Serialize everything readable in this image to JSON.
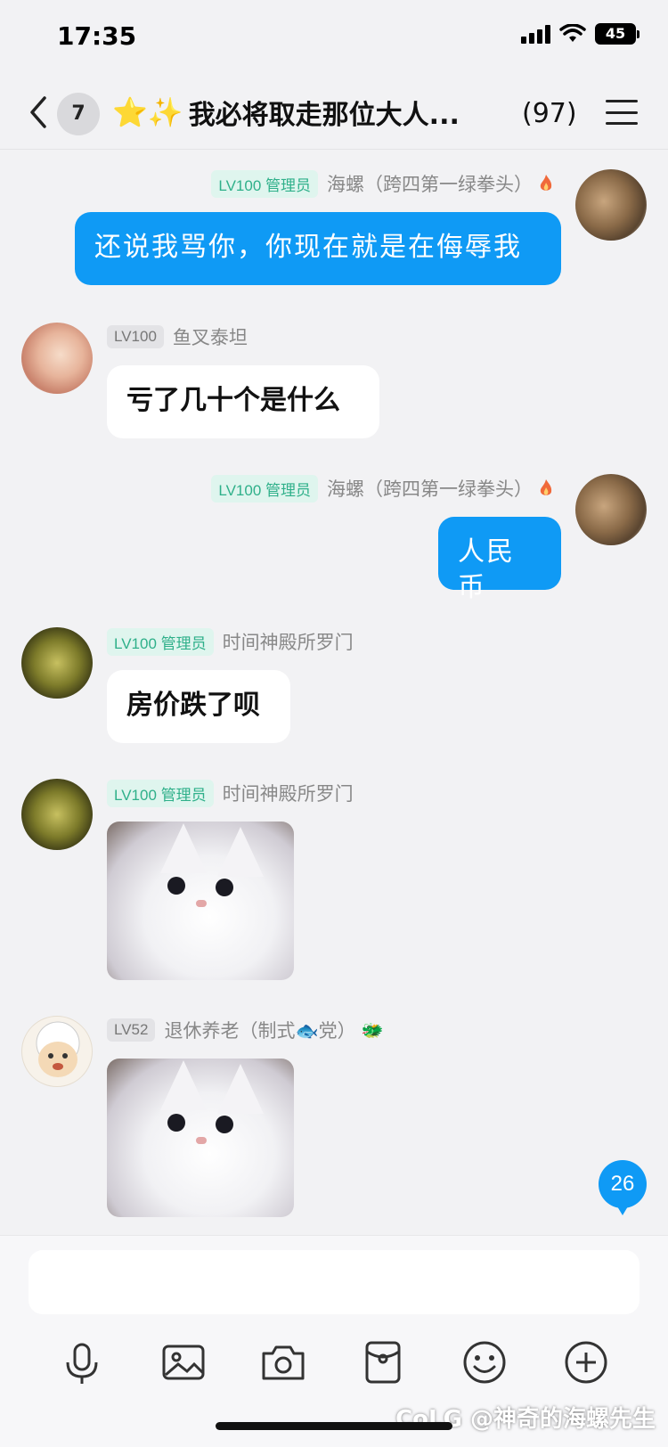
{
  "status_bar": {
    "time": "17:35",
    "battery": "45"
  },
  "header": {
    "unread_count": "7",
    "title_emoji": "⭐✨",
    "title": "我必将取走那位大人...",
    "member_count": "(97)"
  },
  "messages": [
    {
      "side": "right",
      "badge": "LV100 管理员",
      "nickname": "海螺（跨四第一绿拳头）",
      "type": "text",
      "text": "还说我骂你，你现在就是在侮辱我"
    },
    {
      "side": "left",
      "badge": "LV100",
      "nickname": "鱼叉泰坦",
      "type": "text",
      "text": "亏了几十个是什么"
    },
    {
      "side": "right",
      "badge": "LV100 管理员",
      "nickname": "海螺（跨四第一绿拳头）",
      "type": "text",
      "text": "人民币"
    },
    {
      "side": "left",
      "badge": "LV100 管理员",
      "nickname": "时间神殿所罗门",
      "type": "text",
      "text": "房价跌了呗"
    },
    {
      "side": "left",
      "badge": "LV100 管理员",
      "nickname": "时间神殿所罗门",
      "type": "image",
      "image": "white-cat-meme"
    },
    {
      "side": "left",
      "badge": "LV52",
      "nickname": "退休养老（制式🐟党）",
      "nickname_emoji": "🐲",
      "type": "image",
      "image": "white-cat-meme"
    }
  ],
  "unread_bubble": "26",
  "toolbar": [
    "microphone-icon",
    "image-icon",
    "camera-icon",
    "red-packet-icon",
    "emoji-icon",
    "plus-icon"
  ],
  "watermark": "CoLG @神奇的海螺先生",
  "colors": {
    "accent_blue": "#0f9af5",
    "admin_badge_text": "#2fb08a",
    "admin_badge_bg": "#dff5ee",
    "background": "#f2f2f4"
  }
}
